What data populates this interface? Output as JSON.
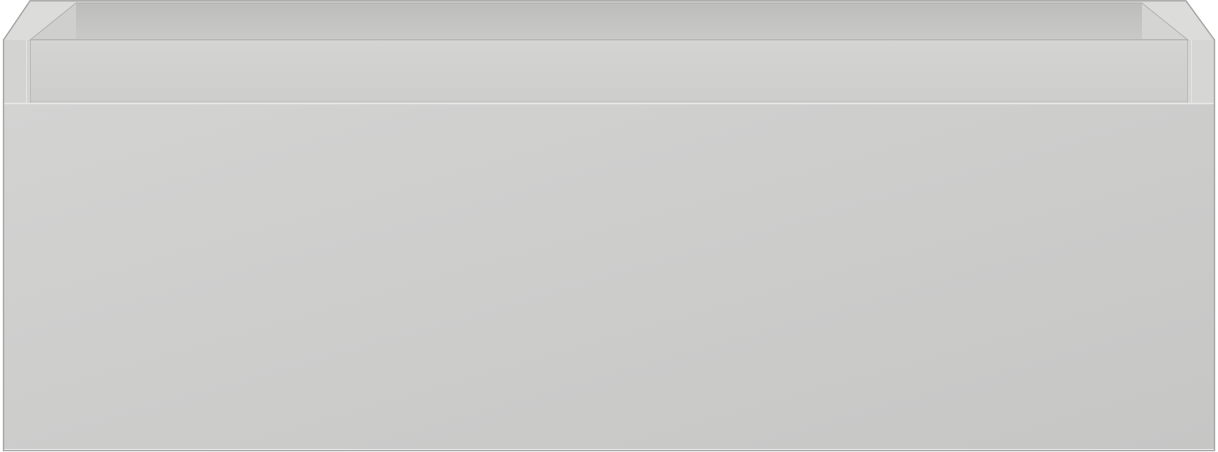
{
  "object": {
    "kind": "drawer-box",
    "colors": {
      "background": "#ffffff",
      "front_panel": "#cbcbca",
      "front_panel_light": "#d2d2d1",
      "inner_back_wall": "#c2c2c1",
      "top_rim": "#d8d8d7",
      "rim_band": "#d1d1d0",
      "edge_highlight": "#e6e6e5",
      "edge_shadow": "#aeaead",
      "outline": "#a9a9a8"
    }
  }
}
